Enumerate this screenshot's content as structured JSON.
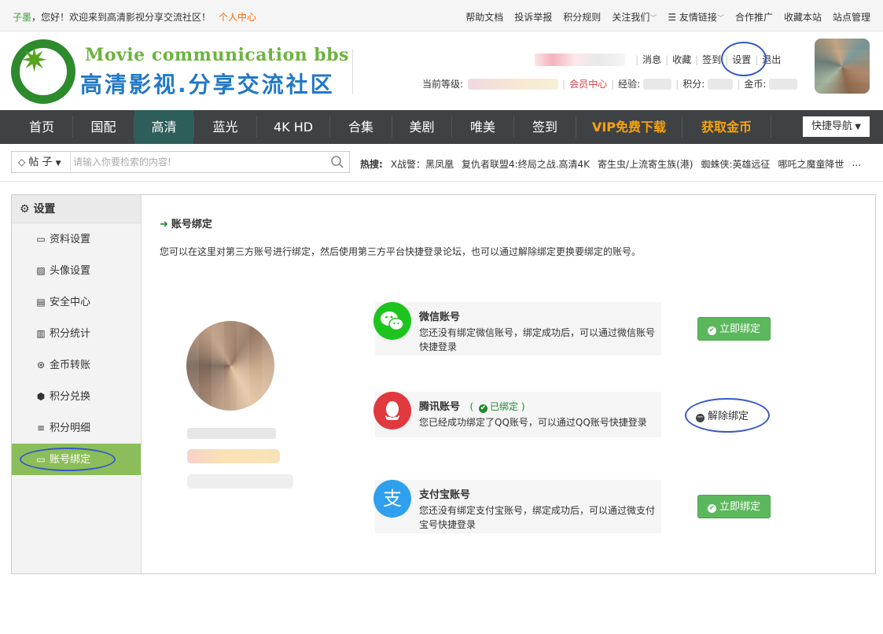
{
  "topbar": {
    "user": "子墨",
    "welcome": "，您好！欢迎来到高清影视分享交流社区！",
    "center": "个人中心",
    "links": [
      "帮助文档",
      "投诉举报",
      "积分规则",
      "关注我们",
      "友情链接",
      "合作推广",
      "收藏本站",
      "站点管理"
    ]
  },
  "header": {
    "logo_en": "Movie communication bbs",
    "logo_cn": "高清影视.分享交流社区",
    "user_links": {
      "message": "消息",
      "favorite": "收藏",
      "checkin": "签到",
      "settings": "设置",
      "logout": "退出"
    },
    "stats": {
      "level_label": "当前等级:",
      "vip": "会员中心",
      "exp_label": "经验:",
      "points_label": "积分:",
      "gold_label": "金币:"
    }
  },
  "nav": {
    "items": [
      "首页",
      "国配",
      "高清",
      "蓝光",
      "4K HD",
      "合集",
      "美剧",
      "唯美",
      "签到",
      "VIP免费下载",
      "获取金币"
    ],
    "active": "高清",
    "quick": "快捷导航"
  },
  "search": {
    "type": "帖 子",
    "placeholder": "请输入你要检索的内容!",
    "hot_label": "热搜:",
    "hot": [
      "X战警：黑凤凰",
      "复仇者联盟4:终局之战.高清4K",
      "寄生虫/上流寄生族(港)",
      "蜘蛛侠:英雄远征",
      "哪吒之魔童降世",
      "..."
    ]
  },
  "sidebar": {
    "title": "设置",
    "items": [
      {
        "label": "资料设置",
        "icon": "card-icon"
      },
      {
        "label": "头像设置",
        "icon": "image-icon"
      },
      {
        "label": "安全中心",
        "icon": "id-card-icon"
      },
      {
        "label": "积分统计",
        "icon": "bar-chart-icon"
      },
      {
        "label": "金币转账",
        "icon": "coin-icon"
      },
      {
        "label": "积分兑换",
        "icon": "cube-icon"
      },
      {
        "label": "积分明细",
        "icon": "list-icon"
      },
      {
        "label": "账号绑定",
        "icon": "card-icon"
      }
    ],
    "active": "账号绑定"
  },
  "content": {
    "title": "账号绑定",
    "desc": "您可以在这里对第三方账号进行绑定，然后使用第三方平台快捷登录论坛，也可以通过解除绑定更换要绑定的账号。",
    "accounts": [
      {
        "name": "微信账号",
        "note": "您还没有绑定微信账号，绑定成功后，可以通过微信账号快捷登录",
        "action": "立即绑定",
        "color": "#1ec41e"
      },
      {
        "name": "腾讯账号",
        "status": "已绑定",
        "note": "您已经成功绑定了QQ账号，可以通过QQ账号快捷登录",
        "action": "解除绑定",
        "color": "#e0393e"
      },
      {
        "name": "支付宝账号",
        "note": "您还没有绑定支付宝账号，绑定成功后，可以通过微支付宝号快捷登录",
        "action": "立即绑定",
        "color": "#2fa0ee"
      }
    ]
  },
  "colors": {
    "nav_bg": "#3f4244",
    "active_green": "#8cbd5b",
    "bind_btn": "#5cb85c",
    "annotation": "#3659c8"
  }
}
